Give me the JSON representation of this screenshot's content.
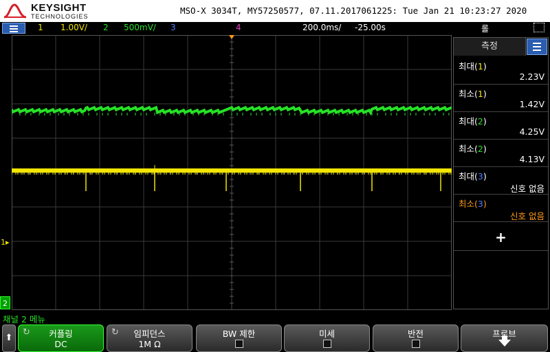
{
  "header": {
    "brand": "KEYSIGHT",
    "brand_sub": "TECHNOLOGIES",
    "title": "MSO-X 3034T, MY57250577, 07.11.2017061225: Tue Jan 21 10:23:27 2020"
  },
  "status_bar": {
    "ch1_num": "1",
    "ch1_scale": "1.00V/",
    "ch2_num": "2",
    "ch2_scale": "500mV/",
    "ch3_num": "3",
    "ch4_num": "4",
    "timebase": "200.0ms/",
    "delay": "-25.00s",
    "trigger_mode": "롤"
  },
  "colors": {
    "ch1": "#f2e500",
    "ch2": "#27e027",
    "ch3": "#4a7dff",
    "ch4": "#e040c0",
    "orange": "#ff9a1a",
    "grid": "#3a3a3a"
  },
  "side_panel": {
    "title": "측정",
    "measurements": [
      {
        "name": "최대",
        "channel": "1",
        "value": "2.23V",
        "color": "ch1"
      },
      {
        "name": "최소",
        "channel": "1",
        "value": "1.42V",
        "color": "ch1"
      },
      {
        "name": "최대",
        "channel": "2",
        "value": "4.25V",
        "color": "ch2"
      },
      {
        "name": "최소",
        "channel": "2",
        "value": "4.13V",
        "color": "ch2"
      },
      {
        "name": "최대",
        "channel": "3",
        "value": "신호 없음",
        "color": "ch3"
      },
      {
        "name": "최소",
        "channel": "3",
        "value": "신호 없음",
        "color": "ch3",
        "highlight": true
      }
    ],
    "add_label": "+"
  },
  "channel_markers": {
    "ch1": "1",
    "ch2": "2"
  },
  "bottom": {
    "menu_name": "채널 2 메뉴",
    "keys": [
      {
        "label": "커플링",
        "value": "DC",
        "active": true
      },
      {
        "label": "임피던스",
        "value": "1M Ω"
      },
      {
        "label": "BW 제한",
        "checkbox": true
      },
      {
        "label": "미세",
        "checkbox": true
      },
      {
        "label": "반전",
        "checkbox": true
      },
      {
        "label": "프로브",
        "arrow": true
      }
    ]
  },
  "icons": [
    "menu-icon",
    "up-arrow-icon",
    "rotate-knob-icon",
    "down-arrow-icon",
    "add-icon",
    "screenshot-box-icon"
  ]
}
